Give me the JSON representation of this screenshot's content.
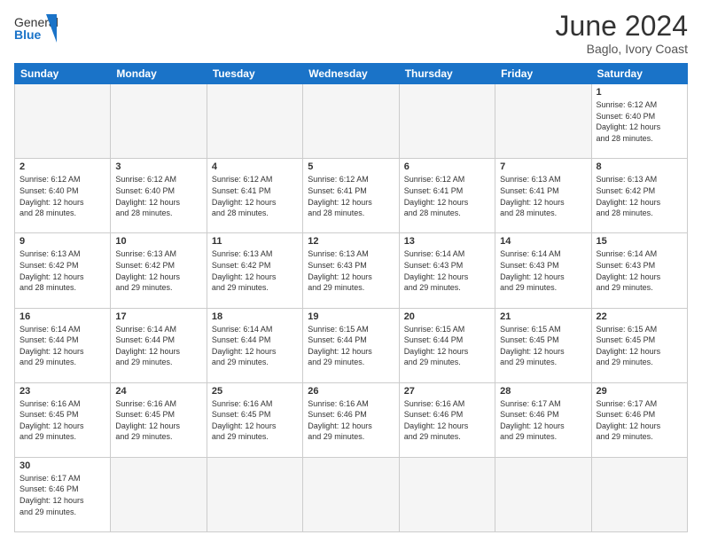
{
  "header": {
    "logo_general": "General",
    "logo_blue": "Blue",
    "title": "June 2024",
    "subtitle": "Baglo, Ivory Coast"
  },
  "weekdays": [
    "Sunday",
    "Monday",
    "Tuesday",
    "Wednesday",
    "Thursday",
    "Friday",
    "Saturday"
  ],
  "weeks": [
    [
      {
        "day": "",
        "info": ""
      },
      {
        "day": "",
        "info": ""
      },
      {
        "day": "",
        "info": ""
      },
      {
        "day": "",
        "info": ""
      },
      {
        "day": "",
        "info": ""
      },
      {
        "day": "",
        "info": ""
      },
      {
        "day": "1",
        "info": "Sunrise: 6:12 AM\nSunset: 6:40 PM\nDaylight: 12 hours\nand 28 minutes."
      }
    ],
    [
      {
        "day": "2",
        "info": "Sunrise: 6:12 AM\nSunset: 6:40 PM\nDaylight: 12 hours\nand 28 minutes."
      },
      {
        "day": "3",
        "info": "Sunrise: 6:12 AM\nSunset: 6:40 PM\nDaylight: 12 hours\nand 28 minutes."
      },
      {
        "day": "4",
        "info": "Sunrise: 6:12 AM\nSunset: 6:41 PM\nDaylight: 12 hours\nand 28 minutes."
      },
      {
        "day": "5",
        "info": "Sunrise: 6:12 AM\nSunset: 6:41 PM\nDaylight: 12 hours\nand 28 minutes."
      },
      {
        "day": "6",
        "info": "Sunrise: 6:12 AM\nSunset: 6:41 PM\nDaylight: 12 hours\nand 28 minutes."
      },
      {
        "day": "7",
        "info": "Sunrise: 6:13 AM\nSunset: 6:41 PM\nDaylight: 12 hours\nand 28 minutes."
      },
      {
        "day": "8",
        "info": "Sunrise: 6:13 AM\nSunset: 6:42 PM\nDaylight: 12 hours\nand 28 minutes."
      }
    ],
    [
      {
        "day": "9",
        "info": "Sunrise: 6:13 AM\nSunset: 6:42 PM\nDaylight: 12 hours\nand 28 minutes."
      },
      {
        "day": "10",
        "info": "Sunrise: 6:13 AM\nSunset: 6:42 PM\nDaylight: 12 hours\nand 29 minutes."
      },
      {
        "day": "11",
        "info": "Sunrise: 6:13 AM\nSunset: 6:42 PM\nDaylight: 12 hours\nand 29 minutes."
      },
      {
        "day": "12",
        "info": "Sunrise: 6:13 AM\nSunset: 6:43 PM\nDaylight: 12 hours\nand 29 minutes."
      },
      {
        "day": "13",
        "info": "Sunrise: 6:14 AM\nSunset: 6:43 PM\nDaylight: 12 hours\nand 29 minutes."
      },
      {
        "day": "14",
        "info": "Sunrise: 6:14 AM\nSunset: 6:43 PM\nDaylight: 12 hours\nand 29 minutes."
      },
      {
        "day": "15",
        "info": "Sunrise: 6:14 AM\nSunset: 6:43 PM\nDaylight: 12 hours\nand 29 minutes."
      }
    ],
    [
      {
        "day": "16",
        "info": "Sunrise: 6:14 AM\nSunset: 6:44 PM\nDaylight: 12 hours\nand 29 minutes."
      },
      {
        "day": "17",
        "info": "Sunrise: 6:14 AM\nSunset: 6:44 PM\nDaylight: 12 hours\nand 29 minutes."
      },
      {
        "day": "18",
        "info": "Sunrise: 6:14 AM\nSunset: 6:44 PM\nDaylight: 12 hours\nand 29 minutes."
      },
      {
        "day": "19",
        "info": "Sunrise: 6:15 AM\nSunset: 6:44 PM\nDaylight: 12 hours\nand 29 minutes."
      },
      {
        "day": "20",
        "info": "Sunrise: 6:15 AM\nSunset: 6:44 PM\nDaylight: 12 hours\nand 29 minutes."
      },
      {
        "day": "21",
        "info": "Sunrise: 6:15 AM\nSunset: 6:45 PM\nDaylight: 12 hours\nand 29 minutes."
      },
      {
        "day": "22",
        "info": "Sunrise: 6:15 AM\nSunset: 6:45 PM\nDaylight: 12 hours\nand 29 minutes."
      }
    ],
    [
      {
        "day": "23",
        "info": "Sunrise: 6:16 AM\nSunset: 6:45 PM\nDaylight: 12 hours\nand 29 minutes."
      },
      {
        "day": "24",
        "info": "Sunrise: 6:16 AM\nSunset: 6:45 PM\nDaylight: 12 hours\nand 29 minutes."
      },
      {
        "day": "25",
        "info": "Sunrise: 6:16 AM\nSunset: 6:45 PM\nDaylight: 12 hours\nand 29 minutes."
      },
      {
        "day": "26",
        "info": "Sunrise: 6:16 AM\nSunset: 6:46 PM\nDaylight: 12 hours\nand 29 minutes."
      },
      {
        "day": "27",
        "info": "Sunrise: 6:16 AM\nSunset: 6:46 PM\nDaylight: 12 hours\nand 29 minutes."
      },
      {
        "day": "28",
        "info": "Sunrise: 6:17 AM\nSunset: 6:46 PM\nDaylight: 12 hours\nand 29 minutes."
      },
      {
        "day": "29",
        "info": "Sunrise: 6:17 AM\nSunset: 6:46 PM\nDaylight: 12 hours\nand 29 minutes."
      }
    ],
    [
      {
        "day": "30",
        "info": "Sunrise: 6:17 AM\nSunset: 6:46 PM\nDaylight: 12 hours\nand 29 minutes."
      },
      {
        "day": "",
        "info": ""
      },
      {
        "day": "",
        "info": ""
      },
      {
        "day": "",
        "info": ""
      },
      {
        "day": "",
        "info": ""
      },
      {
        "day": "",
        "info": ""
      },
      {
        "day": "",
        "info": ""
      }
    ]
  ]
}
